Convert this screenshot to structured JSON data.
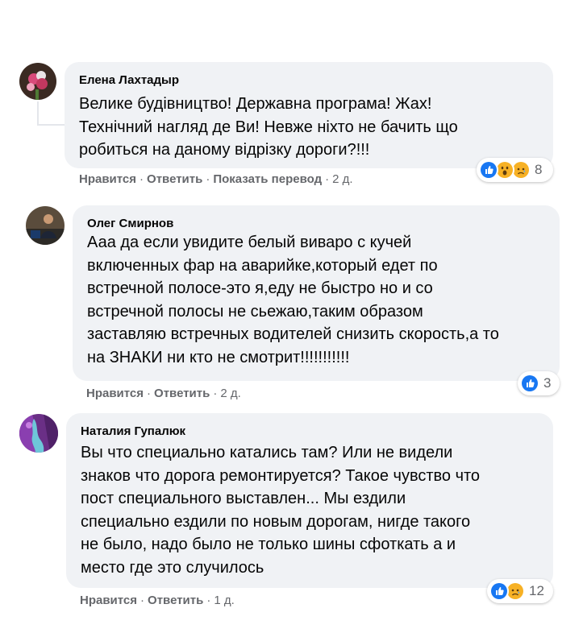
{
  "colors": {
    "bubble": "#f0f2f5",
    "muted": "#65676b",
    "like": "#1877f2",
    "emoji_yellow": "#f7b125"
  },
  "comments": [
    {
      "author": "Елена Лахтадыр",
      "text": "Велике будівництво! Державна програма! Жах!\nТехнічний нагляд де Ви! Невже ніхто не бачить що\nробиться на даному відрізку дороги?!!!",
      "actions": [
        "Нравится",
        "Ответить",
        "Показать перевод"
      ],
      "time": "2 д.",
      "reactions": {
        "icons": [
          "like-icon",
          "wow-icon",
          "sad-icon"
        ],
        "count": "8"
      }
    },
    {
      "author": "Олег Смирнов",
      "text": "Ааа да если увидите белый виваро с кучей\nвключенных фар на аварийке,который едет по\nвстречной полосе-это я,еду не быстро но и со\nвстречной полосы не сьежаю,таким образом\nзаставляю встречных водителей снизить скорость,а то\nна ЗНАКИ ни кто не смотрит!!!!!!!!!!!",
      "actions": [
        "Нравится",
        "Ответить"
      ],
      "time": "2 д.",
      "reactions": {
        "icons": [
          "like-icon"
        ],
        "count": "3"
      }
    },
    {
      "author": "Наталия Гупалюк",
      "text": "Вы что специально катались там? Или не видели\nзнаков что дорога ремонтируется? Такое чувство что\nпост специального выставлен... Мы ездили\nспециально ездили по новым дорогам, нигде такого\nне было, надо было не только шины сфоткать а и\nместо где это случилось",
      "actions": [
        "Нравится",
        "Ответить"
      ],
      "time": "1 д.",
      "reactions": {
        "icons": [
          "like-icon",
          "sad-icon"
        ],
        "count": "12"
      }
    }
  ]
}
